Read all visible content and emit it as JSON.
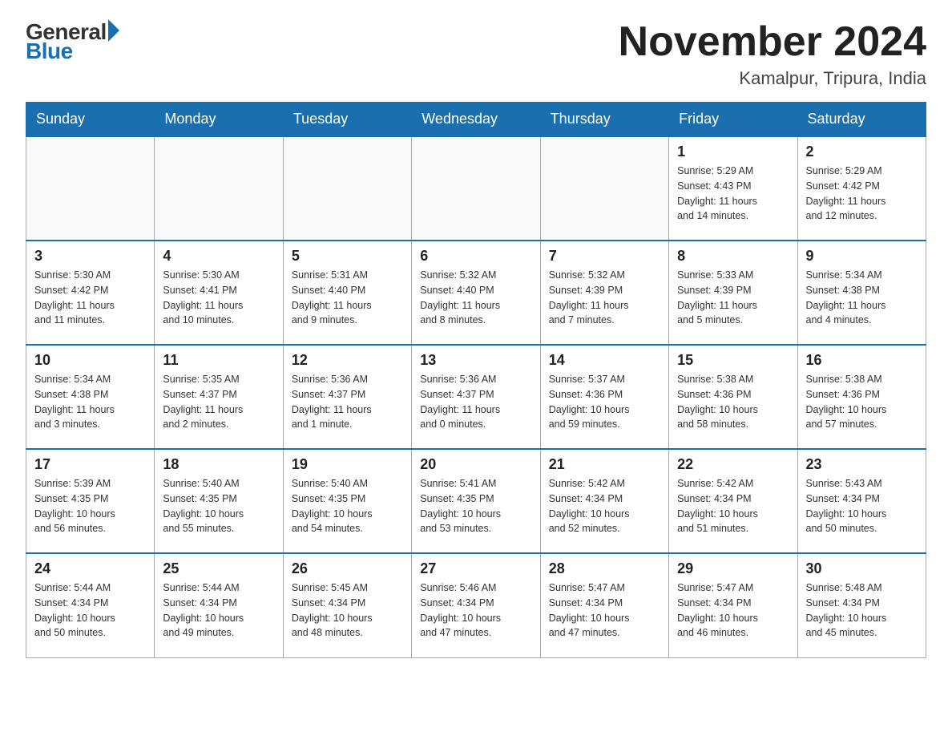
{
  "logo": {
    "general": "General",
    "blue": "Blue"
  },
  "title": "November 2024",
  "subtitle": "Kamalpur, Tripura, India",
  "weekdays": [
    "Sunday",
    "Monday",
    "Tuesday",
    "Wednesday",
    "Thursday",
    "Friday",
    "Saturday"
  ],
  "weeks": [
    [
      {
        "day": "",
        "info": ""
      },
      {
        "day": "",
        "info": ""
      },
      {
        "day": "",
        "info": ""
      },
      {
        "day": "",
        "info": ""
      },
      {
        "day": "",
        "info": ""
      },
      {
        "day": "1",
        "info": "Sunrise: 5:29 AM\nSunset: 4:43 PM\nDaylight: 11 hours\nand 14 minutes."
      },
      {
        "day": "2",
        "info": "Sunrise: 5:29 AM\nSunset: 4:42 PM\nDaylight: 11 hours\nand 12 minutes."
      }
    ],
    [
      {
        "day": "3",
        "info": "Sunrise: 5:30 AM\nSunset: 4:42 PM\nDaylight: 11 hours\nand 11 minutes."
      },
      {
        "day": "4",
        "info": "Sunrise: 5:30 AM\nSunset: 4:41 PM\nDaylight: 11 hours\nand 10 minutes."
      },
      {
        "day": "5",
        "info": "Sunrise: 5:31 AM\nSunset: 4:40 PM\nDaylight: 11 hours\nand 9 minutes."
      },
      {
        "day": "6",
        "info": "Sunrise: 5:32 AM\nSunset: 4:40 PM\nDaylight: 11 hours\nand 8 minutes."
      },
      {
        "day": "7",
        "info": "Sunrise: 5:32 AM\nSunset: 4:39 PM\nDaylight: 11 hours\nand 7 minutes."
      },
      {
        "day": "8",
        "info": "Sunrise: 5:33 AM\nSunset: 4:39 PM\nDaylight: 11 hours\nand 5 minutes."
      },
      {
        "day": "9",
        "info": "Sunrise: 5:34 AM\nSunset: 4:38 PM\nDaylight: 11 hours\nand 4 minutes."
      }
    ],
    [
      {
        "day": "10",
        "info": "Sunrise: 5:34 AM\nSunset: 4:38 PM\nDaylight: 11 hours\nand 3 minutes."
      },
      {
        "day": "11",
        "info": "Sunrise: 5:35 AM\nSunset: 4:37 PM\nDaylight: 11 hours\nand 2 minutes."
      },
      {
        "day": "12",
        "info": "Sunrise: 5:36 AM\nSunset: 4:37 PM\nDaylight: 11 hours\nand 1 minute."
      },
      {
        "day": "13",
        "info": "Sunrise: 5:36 AM\nSunset: 4:37 PM\nDaylight: 11 hours\nand 0 minutes."
      },
      {
        "day": "14",
        "info": "Sunrise: 5:37 AM\nSunset: 4:36 PM\nDaylight: 10 hours\nand 59 minutes."
      },
      {
        "day": "15",
        "info": "Sunrise: 5:38 AM\nSunset: 4:36 PM\nDaylight: 10 hours\nand 58 minutes."
      },
      {
        "day": "16",
        "info": "Sunrise: 5:38 AM\nSunset: 4:36 PM\nDaylight: 10 hours\nand 57 minutes."
      }
    ],
    [
      {
        "day": "17",
        "info": "Sunrise: 5:39 AM\nSunset: 4:35 PM\nDaylight: 10 hours\nand 56 minutes."
      },
      {
        "day": "18",
        "info": "Sunrise: 5:40 AM\nSunset: 4:35 PM\nDaylight: 10 hours\nand 55 minutes."
      },
      {
        "day": "19",
        "info": "Sunrise: 5:40 AM\nSunset: 4:35 PM\nDaylight: 10 hours\nand 54 minutes."
      },
      {
        "day": "20",
        "info": "Sunrise: 5:41 AM\nSunset: 4:35 PM\nDaylight: 10 hours\nand 53 minutes."
      },
      {
        "day": "21",
        "info": "Sunrise: 5:42 AM\nSunset: 4:34 PM\nDaylight: 10 hours\nand 52 minutes."
      },
      {
        "day": "22",
        "info": "Sunrise: 5:42 AM\nSunset: 4:34 PM\nDaylight: 10 hours\nand 51 minutes."
      },
      {
        "day": "23",
        "info": "Sunrise: 5:43 AM\nSunset: 4:34 PM\nDaylight: 10 hours\nand 50 minutes."
      }
    ],
    [
      {
        "day": "24",
        "info": "Sunrise: 5:44 AM\nSunset: 4:34 PM\nDaylight: 10 hours\nand 50 minutes."
      },
      {
        "day": "25",
        "info": "Sunrise: 5:44 AM\nSunset: 4:34 PM\nDaylight: 10 hours\nand 49 minutes."
      },
      {
        "day": "26",
        "info": "Sunrise: 5:45 AM\nSunset: 4:34 PM\nDaylight: 10 hours\nand 48 minutes."
      },
      {
        "day": "27",
        "info": "Sunrise: 5:46 AM\nSunset: 4:34 PM\nDaylight: 10 hours\nand 47 minutes."
      },
      {
        "day": "28",
        "info": "Sunrise: 5:47 AM\nSunset: 4:34 PM\nDaylight: 10 hours\nand 47 minutes."
      },
      {
        "day": "29",
        "info": "Sunrise: 5:47 AM\nSunset: 4:34 PM\nDaylight: 10 hours\nand 46 minutes."
      },
      {
        "day": "30",
        "info": "Sunrise: 5:48 AM\nSunset: 4:34 PM\nDaylight: 10 hours\nand 45 minutes."
      }
    ]
  ]
}
